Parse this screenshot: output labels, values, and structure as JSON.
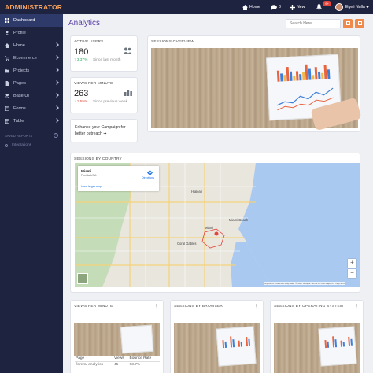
{
  "brand": "ADMINISTRATOR",
  "sidebar": {
    "items": [
      {
        "label": "Dashboard",
        "active": true
      },
      {
        "label": "Profile"
      },
      {
        "label": "Home"
      },
      {
        "label": "Ecommerce"
      },
      {
        "label": "Projects"
      },
      {
        "label": "Pages"
      },
      {
        "label": "Base UI"
      },
      {
        "label": "Forms"
      },
      {
        "label": "Table"
      }
    ],
    "section_label": "SAVED REPORTS",
    "sub_items": [
      {
        "label": "Integrations"
      }
    ]
  },
  "topbar": {
    "home_label": "Home",
    "messages_count": "3",
    "new_label": "New",
    "notif_badge": "9+",
    "user_name": "Egeli Nulla"
  },
  "page": {
    "title": "Analytics",
    "search_placeholder": "Search Here..."
  },
  "stats": {
    "active_users": {
      "title": "ACTIVE USERS",
      "value": "180",
      "delta": "↑ 3.37%",
      "note": "Since last month",
      "delta_color": "#2eae5e"
    },
    "views_per_minute": {
      "title": "VIEWS PER MINUTE",
      "value": "263",
      "delta": "↓ 1.55%",
      "note": "Since previous week",
      "delta_color": "#e2453c"
    }
  },
  "promo": {
    "text": "Enhance your Campaign for better outreach ➞"
  },
  "cards": {
    "sessions_overview": "SESSIONS OVERVIEW",
    "sessions_by_country": "SESSIONS BY COUNTRY",
    "views_per_minute": "VIEWS PER MINUTE",
    "sessions_by_browser": "SESSIONS BY BROWSER",
    "sessions_by_os": "SESSIONS BY OPERATING SYSTEM"
  },
  "map": {
    "place_name": "Miami",
    "place_sub": "Florida USA",
    "view_link": "View larger map",
    "directions": "Directions",
    "labels": [
      "Hialeah",
      "Miami Beach",
      "Coral Gables",
      "Miami"
    ],
    "footer": "Keyboard shortcuts   Map data ©2022 Google   Terms of Use   Report a map error"
  },
  "vpm_table": {
    "headers": [
      "Page",
      "Views",
      "Bounce Rate"
    ],
    "rows": [
      [
        "/lorem/-analytics",
        "45",
        "63.7%"
      ]
    ]
  },
  "colors": {
    "accent": "#f08a4b",
    "title": "#5a3fa6",
    "sidebar": "#1e2340"
  }
}
